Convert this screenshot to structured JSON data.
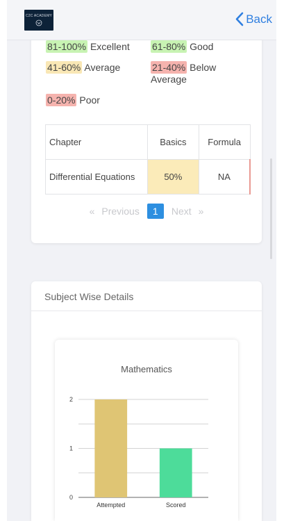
{
  "navbar": {
    "logo_text": "C2C ACADEMY",
    "back_label": "Back",
    "back_icon": "chevron-left-icon",
    "accent": "#2f7fe0"
  },
  "legend": [
    {
      "range": "81-100%",
      "label": "Excellent",
      "color": "#c8f3b3"
    },
    {
      "range": "61-80%",
      "label": "Good",
      "color": "#c8f3b3"
    },
    {
      "range": "41-60%",
      "label": "Average",
      "color": "#f9e7b5"
    },
    {
      "range": "21-40%",
      "label": "Below Average",
      "color": "#f5b3ae"
    },
    {
      "range": "0-20%",
      "label": "Poor",
      "color": "#f5b3ae"
    }
  ],
  "table": {
    "headers": [
      "Chapter",
      "Basics",
      "Formula"
    ],
    "rows": [
      [
        "Differential Equations",
        "50%",
        "NA"
      ]
    ]
  },
  "pagination": {
    "first": "«",
    "previous": "Previous",
    "current": "1",
    "next": "Next",
    "last": "»"
  },
  "subject_section": {
    "title": "Subject Wise Details"
  },
  "chart_data": {
    "type": "bar",
    "title": "Mathematics",
    "categories": [
      "Attempted",
      "Scored"
    ],
    "values": [
      2,
      1
    ],
    "colors": [
      "#dfc574",
      "#4ddc9a"
    ],
    "ylim": [
      0,
      2
    ],
    "yticks": [
      0,
      1,
      2
    ],
    "grid": true
  }
}
